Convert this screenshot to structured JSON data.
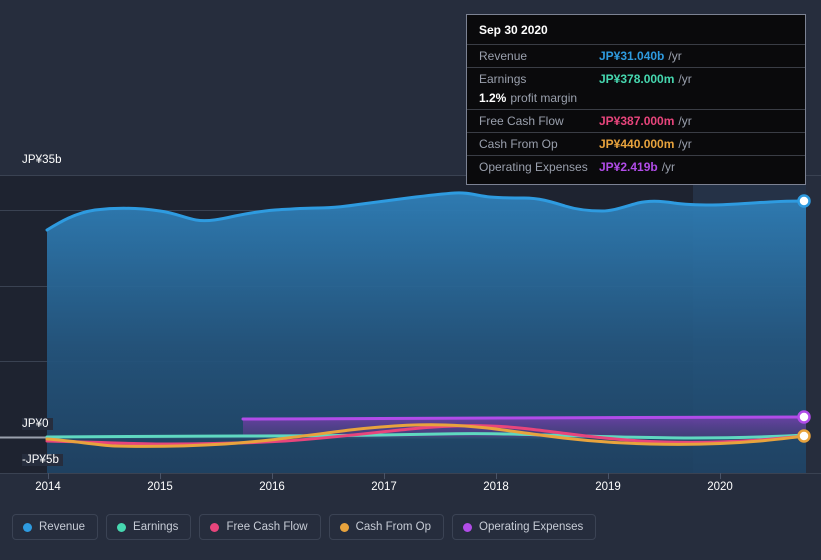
{
  "theme": {
    "background": "#262d3d",
    "plot_background": "#1e2330",
    "grid_color": "#39404f",
    "axis_text": "#ffffff",
    "highlight_band": "#263246"
  },
  "tooltip": {
    "date": "Sep 30 2020",
    "rows": [
      {
        "name": "Revenue",
        "value": "JP¥31.040b",
        "unit": "/yr",
        "color": "#2e9be0"
      },
      {
        "name": "Earnings",
        "value": "JP¥378.000m",
        "unit": "/yr",
        "color": "#46d8b0"
      },
      {
        "name": "Free Cash Flow",
        "value": "JP¥387.000m",
        "unit": "/yr",
        "color": "#e8457c"
      },
      {
        "name": "Cash From Op",
        "value": "JP¥440.000m",
        "unit": "/yr",
        "color": "#e8a33d"
      },
      {
        "name": "Operating Expenses",
        "value": "JP¥2.419b",
        "unit": "/yr",
        "color": "#b14ce8"
      }
    ],
    "margin_value": "1.2%",
    "margin_label": "profit margin"
  },
  "legend": {
    "items": [
      {
        "label": "Revenue",
        "color": "#2e9be0",
        "key": "revenue"
      },
      {
        "label": "Earnings",
        "color": "#46d8b0",
        "key": "earnings"
      },
      {
        "label": "Free Cash Flow",
        "color": "#e8457c",
        "key": "free-cash-flow"
      },
      {
        "label": "Cash From Op",
        "color": "#e8a33d",
        "key": "cash-from-op"
      },
      {
        "label": "Operating Expenses",
        "color": "#b14ce8",
        "key": "operating-expenses"
      }
    ]
  },
  "axes": {
    "y_labels": {
      "top": "JP¥35b",
      "zero": "JP¥0",
      "bottom": "-JP¥5b"
    },
    "x_labels": [
      "2014",
      "2015",
      "2016",
      "2017",
      "2018",
      "2019",
      "2020"
    ]
  },
  "chart_data": {
    "type": "area",
    "title": "",
    "xlabel": "",
    "ylabel": "",
    "currency": "JP¥",
    "ylim": [
      -5,
      35
    ],
    "y_ticks": [
      35,
      30,
      20,
      10,
      0,
      -5
    ],
    "y_tick_labels": [
      "JP¥35b",
      "",
      "",
      "",
      "JP¥0",
      "-JP¥5b"
    ],
    "grid": true,
    "legend_position": "bottom-left",
    "xlim": [
      "2014",
      "2020.8"
    ],
    "x_ticks": [
      "2014",
      "2015",
      "2016",
      "2017",
      "2018",
      "2019",
      "2020"
    ],
    "highlight_band": {
      "from": "2019.75",
      "to": "2020.8"
    },
    "units": {
      "revenue": "billions JPY",
      "others": "billions JPY"
    },
    "x": [
      2014.0,
      2014.25,
      2014.5,
      2014.75,
      2015.0,
      2015.25,
      2015.5,
      2015.75,
      2016.0,
      2016.25,
      2016.5,
      2016.75,
      2017.0,
      2017.25,
      2017.5,
      2017.75,
      2018.0,
      2018.25,
      2018.5,
      2018.75,
      2019.0,
      2019.25,
      2019.5,
      2019.75,
      2020.0,
      2020.25,
      2020.5,
      2020.75
    ],
    "series": [
      {
        "name": "Revenue",
        "color": "#2e9be0",
        "filled": true,
        "values": [
          27.3,
          28.8,
          29.6,
          29.9,
          30.0,
          29.6,
          29.3,
          29.5,
          29.9,
          30.2,
          30.3,
          30.3,
          30.4,
          30.7,
          31.0,
          31.4,
          31.8,
          32.1,
          31.9,
          31.8,
          31.6,
          30.9,
          30.6,
          30.7,
          31.2,
          31.0,
          30.9,
          31.04
        ],
        "last_value_label": "JP¥31.040b"
      },
      {
        "name": "Earnings",
        "color": "#46d8b0",
        "filled": false,
        "values": [
          0.05,
          0.05,
          0.05,
          0.06,
          0.06,
          0.07,
          0.07,
          0.08,
          0.08,
          0.08,
          0.09,
          0.1,
          0.12,
          0.16,
          0.22,
          0.28,
          0.33,
          0.35,
          0.33,
          0.29,
          0.24,
          0.2,
          0.18,
          0.18,
          0.21,
          0.26,
          0.32,
          0.378
        ],
        "last_value_label": "JP¥378.000m"
      },
      {
        "name": "Free Cash Flow",
        "color": "#e8457c",
        "filled": false,
        "values": [
          -0.1,
          -0.15,
          -0.25,
          -0.35,
          -0.38,
          -0.3,
          -0.2,
          -0.12,
          -0.05,
          0.02,
          0.1,
          0.2,
          0.35,
          0.55,
          0.78,
          0.95,
          1.02,
          0.98,
          0.82,
          0.58,
          0.3,
          0.08,
          -0.05,
          -0.08,
          0.02,
          0.15,
          0.28,
          0.387
        ],
        "last_value_label": "JP¥387.000m"
      },
      {
        "name": "Cash From Op",
        "color": "#e8a33d",
        "filled": false,
        "values": [
          -0.08,
          -0.18,
          -0.3,
          -0.42,
          -0.45,
          -0.35,
          -0.24,
          -0.14,
          -0.04,
          0.06,
          0.16,
          0.28,
          0.45,
          0.68,
          0.9,
          1.06,
          1.12,
          1.06,
          0.88,
          0.62,
          0.34,
          0.1,
          -0.02,
          -0.06,
          0.05,
          0.2,
          0.33,
          0.44
        ],
        "last_value_label": "JP¥440.000m"
      },
      {
        "name": "Operating Expenses",
        "color": "#b14ce8",
        "filled": true,
        "starts_at": 2015.75,
        "values": [
          null,
          null,
          null,
          null,
          null,
          null,
          null,
          2.3,
          2.31,
          2.32,
          2.33,
          2.34,
          2.35,
          2.36,
          2.37,
          2.38,
          2.39,
          2.4,
          2.4,
          2.41,
          2.41,
          2.41,
          2.41,
          2.41,
          2.41,
          2.41,
          2.42,
          2.419
        ],
        "last_value_label": "JP¥2.419b"
      }
    ]
  }
}
